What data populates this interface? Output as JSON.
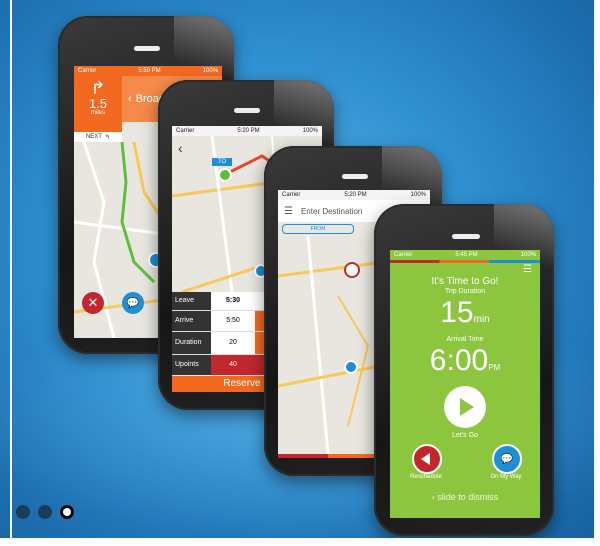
{
  "phone1": {
    "status_carrier": "Carrier",
    "status_time": "5:50 PM",
    "status_battery": "100%",
    "distance": "1.5",
    "distance_unit": "miles",
    "street": "Broad",
    "next_label": "NEXT"
  },
  "phone2": {
    "status_carrier": "Carrier",
    "status_time": "5:20 PM",
    "status_battery": "100%",
    "to_badge": "TO",
    "rows": [
      {
        "label": "Leave",
        "col1": "5:30",
        "col2": "5:"
      },
      {
        "label": "Arrive",
        "col1": "5:50",
        "col2": "6("
      },
      {
        "label": "Duration",
        "col1": "20",
        "col2": ""
      },
      {
        "label": "Upoints",
        "col1": "40",
        "col2": ""
      }
    ],
    "reserve_button": "Reserve R"
  },
  "phone3": {
    "status_carrier": "Carrier",
    "status_time": "5:20 PM",
    "status_battery": "100%",
    "search_placeholder": "Enter Destination",
    "from_label": "FROM"
  },
  "phone4": {
    "status_carrier": "Carrier",
    "status_time": "5:45 PM",
    "status_battery": "100%",
    "headline": "It's Time to Go!",
    "trip_label": "Trip Duration",
    "trip_value": "15",
    "trip_unit": "min",
    "arrival_label": "Arrival Time",
    "arrival_value": "6:00",
    "arrival_unit": "PM",
    "play_label": "Let's Go",
    "reschedule_label": "Reschedule",
    "onmyway_label": "On My Way",
    "dismiss_label": "slide to dismiss"
  },
  "colors": {
    "orange": "#f26a21",
    "green": "#8cc63f",
    "red": "#c1272d",
    "blue": "#1c8fd6"
  },
  "carousel": {
    "count": 3,
    "active_index": 2
  }
}
